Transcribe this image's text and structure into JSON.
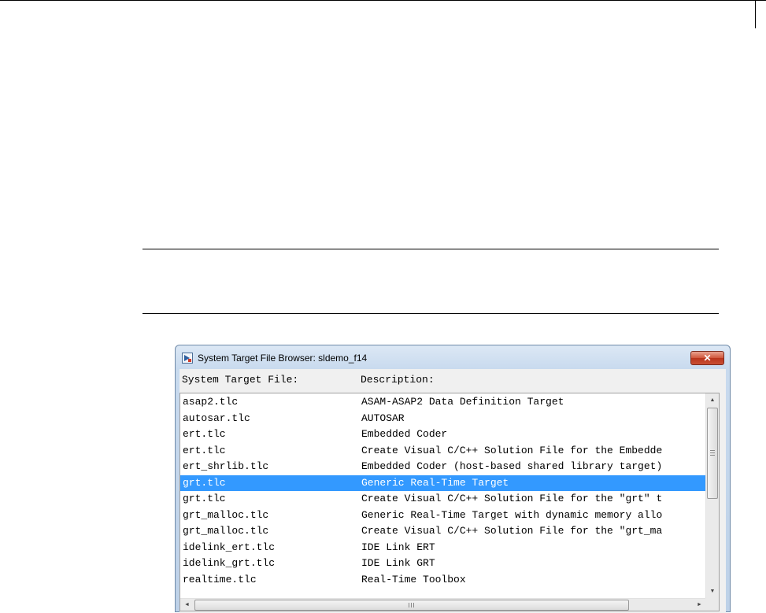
{
  "dialog": {
    "title": "System Target File Browser: sldemo_f14",
    "close_label": "✕",
    "column_headers": {
      "file": "System Target File:",
      "description": "Description:"
    },
    "rows": [
      {
        "file": "asap2.tlc",
        "description": "ASAM-ASAP2 Data Definition Target",
        "selected": false
      },
      {
        "file": "autosar.tlc",
        "description": "AUTOSAR",
        "selected": false
      },
      {
        "file": "ert.tlc",
        "description": "Embedded Coder",
        "selected": false
      },
      {
        "file": "ert.tlc",
        "description": "Create Visual C/C++ Solution File for the Embedde",
        "selected": false
      },
      {
        "file": "ert_shrlib.tlc",
        "description": "Embedded Coder (host-based shared library target)",
        "selected": false
      },
      {
        "file": "grt.tlc",
        "description": "Generic Real-Time Target",
        "selected": true
      },
      {
        "file": "grt.tlc",
        "description": "Create Visual C/C++ Solution File for the \"grt\" t",
        "selected": false
      },
      {
        "file": "grt_malloc.tlc",
        "description": "Generic Real-Time Target with dynamic memory allo",
        "selected": false
      },
      {
        "file": "grt_malloc.tlc",
        "description": "Create Visual C/C++ Solution File for the \"grt_ma",
        "selected": false
      },
      {
        "file": "idelink_ert.tlc",
        "description": "IDE Link ERT",
        "selected": false
      },
      {
        "file": "idelink_grt.tlc",
        "description": "IDE Link GRT",
        "selected": false
      },
      {
        "file": "realtime.tlc",
        "description": "Real-Time Toolbox",
        "selected": false
      }
    ],
    "scrollbar_icons": {
      "up": "▲",
      "down": "▼",
      "left": "◄",
      "right": "►"
    },
    "colors": {
      "selection": "#3399ff",
      "close_button": "#c94f34",
      "title_bar": "#c8daee"
    }
  }
}
